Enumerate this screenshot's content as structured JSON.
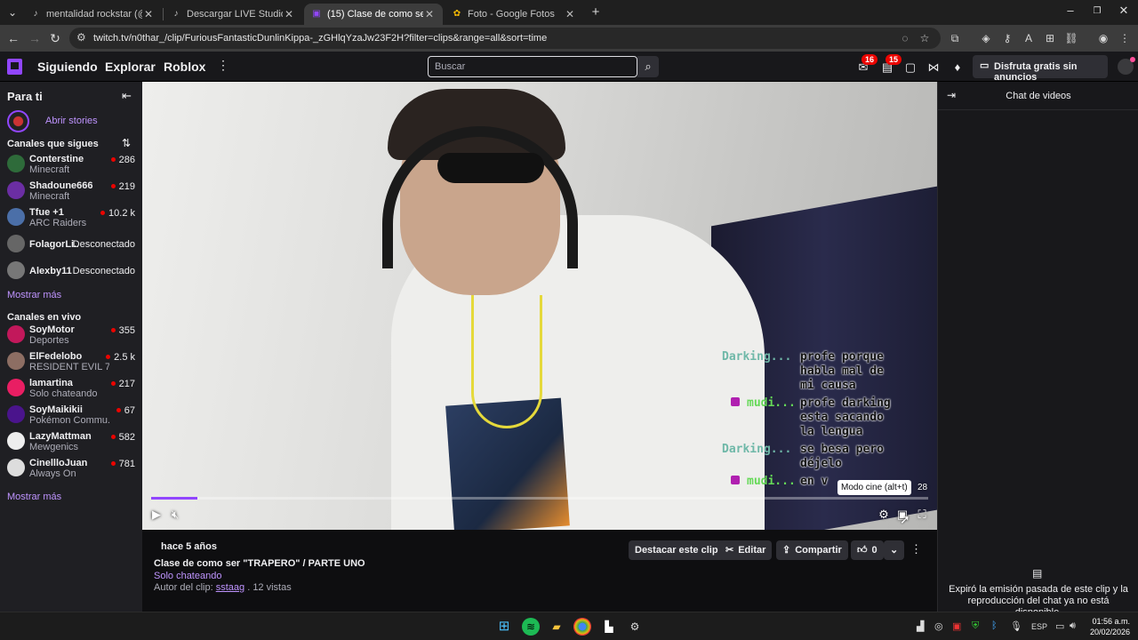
{
  "browser": {
    "tabs": [
      {
        "label": "mentalidad rockstar (@mentalid",
        "icon": "tiktok-icon"
      },
      {
        "label": "Descargar LIVE Studio | TikTok",
        "icon": "tiktok-icon"
      },
      {
        "label": "(15) Clase de como ser \"TRAPER",
        "icon": "twitch-icon",
        "active": true
      },
      {
        "label": "Foto - Google Fotos",
        "icon": "google-photos-icon"
      }
    ],
    "url": "twitch.tv/n0thar_/clip/FuriousFantasticDunlinKippa-_zGHlqYzaJw23F2H?filter=clips&range=all&sort=time"
  },
  "twitch_nav": {
    "links": [
      "Siguiendo",
      "Explorar",
      "Roblox"
    ],
    "search_placeholder": "Buscar",
    "notif_count": "16",
    "inbox_count": "15",
    "turbo_label": "Disfruta gratis sin anuncios"
  },
  "sidebar": {
    "title": "Para ti",
    "stories_label": "Abrir stories",
    "followed_title": "Canales que sigues",
    "followed": [
      {
        "name": "Conterstine",
        "game": "Minecraft",
        "viewers": "286",
        "color": "#2e6b3a"
      },
      {
        "name": "Shadoune666",
        "game": "Minecraft",
        "viewers": "219",
        "color": "#6b2ea3"
      },
      {
        "name": "Tfue +1",
        "game": "ARC Raiders",
        "viewers": "10.2 k",
        "color": "#4b6fa8"
      },
      {
        "name": "FolagorLi...",
        "status": "Desconectado",
        "color": "#666666"
      },
      {
        "name": "Alexby11",
        "status": "Desconectado",
        "color": "#777777"
      }
    ],
    "show_more_1": "Mostrar más",
    "live_title": "Canales en vivo",
    "live": [
      {
        "name": "SoyMotor",
        "game": "Deportes",
        "viewers": "355",
        "color": "#c2185b"
      },
      {
        "name": "ElFedelobo",
        "game": "RESIDENT EVIL 7...",
        "viewers": "2.5 k",
        "color": "#8d6e63"
      },
      {
        "name": "lamartina",
        "game": "Solo chateando",
        "viewers": "217",
        "color": "#e91e63"
      },
      {
        "name": "SoyMaikikii",
        "game": "Pokémon Commu...",
        "viewers": "67",
        "color": "#4a148c"
      },
      {
        "name": "LazyMattman",
        "game": "Mewgenics",
        "viewers": "582",
        "color": "#eeeeee"
      },
      {
        "name": "CinellloJuan",
        "game": "Always On",
        "viewers": "781",
        "color": "#dddddd"
      }
    ],
    "show_more_2": "Mostrar más"
  },
  "video": {
    "overlay_chat": [
      {
        "user": "Darking...",
        "lines": [
          "profe porque",
          "habla mal de",
          "mi causa"
        ],
        "heart": false
      },
      {
        "user": "mudi...",
        "lines": [
          "profe darking",
          "esta sacando",
          "la lengua"
        ],
        "heart": true
      },
      {
        "user": "Darking...",
        "lines": [
          "se besa pero",
          "déjelo"
        ],
        "heart": false
      },
      {
        "user": "mudi...",
        "lines": [
          "en v"
        ],
        "heart": true
      }
    ],
    "progress": 0.06,
    "time_right": "28",
    "tooltip": "Modo cine (alt+t)"
  },
  "clip": {
    "when": "hace 5 años",
    "title": "Clase de como ser \"TRAPERO\" / PARTE UNO",
    "category": "Solo chateando",
    "author_prefix": "Autor del clip:",
    "author": "sstaag",
    "views": ". 12 vistas",
    "buttons": {
      "feature": "Destacar este clip",
      "edit": "Editar",
      "share": "Compartir",
      "likes": "0"
    }
  },
  "chat": {
    "title": "Chat de videos",
    "expired_msg": "Expiró la emisión pasada de este clip y la reproducción del chat ya no está disponible."
  },
  "taskbar": {
    "lang": "ESP",
    "time": "01:56 a.m.",
    "date": "20/02/2026"
  }
}
